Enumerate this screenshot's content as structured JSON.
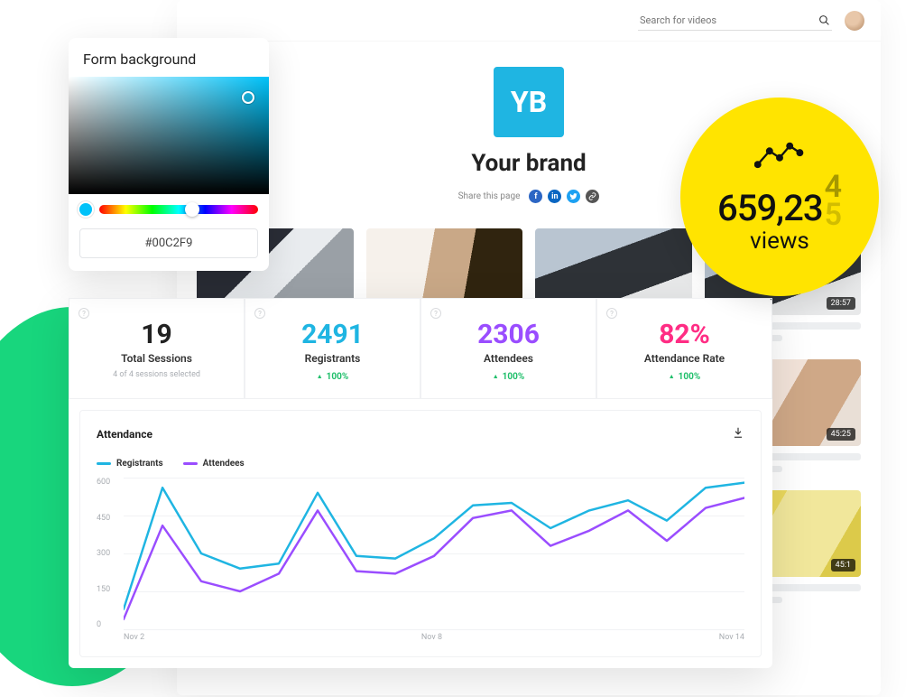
{
  "brand": {
    "logo_text": "YB",
    "name": "Your brand",
    "share_label": "Share this page",
    "search_placeholder": "Search for videos",
    "socials": [
      "facebook",
      "linkedin",
      "twitter",
      "link"
    ]
  },
  "thumbnails": [
    {
      "duration": ""
    },
    {
      "duration": ""
    },
    {
      "duration": ""
    },
    {
      "duration": "28:57"
    },
    {
      "duration": ""
    },
    {
      "duration": ""
    },
    {
      "duration": ""
    },
    {
      "duration": "45:25"
    },
    {
      "duration": ""
    },
    {
      "duration": ""
    },
    {
      "duration": ""
    },
    {
      "duration": "45:1"
    }
  ],
  "picker": {
    "title": "Form background",
    "hex": "#00C2F9"
  },
  "views_badge": {
    "count_prefix": "659,23",
    "ticker_top": "4",
    "ticker_bottom": "5",
    "label": "views"
  },
  "stats": [
    {
      "value": "19",
      "label": "Total Sessions",
      "sub": "4 of 4 sessions selected",
      "delta": "",
      "color": "c-black"
    },
    {
      "value": "2491",
      "label": "Registrants",
      "sub": "",
      "delta": "100%",
      "color": "c-teal"
    },
    {
      "value": "2306",
      "label": "Attendees",
      "sub": "",
      "delta": "100%",
      "color": "c-purple"
    },
    {
      "value": "82%",
      "label": "Attendance Rate",
      "sub": "",
      "delta": "100%",
      "color": "c-pink"
    }
  ],
  "chart": {
    "title": "Attendance",
    "legend": [
      {
        "name": "Registrants",
        "color": "teal"
      },
      {
        "name": "Attendees",
        "color": "purple"
      }
    ]
  },
  "chart_data": {
    "type": "line",
    "title": "Attendance",
    "xlabel": "",
    "ylabel": "",
    "ylim": [
      0,
      600
    ],
    "y_ticks": [
      600,
      450,
      300,
      150,
      0
    ],
    "categories": [
      "Nov 2",
      "",
      "",
      "",
      "",
      "",
      "Nov 8",
      "",
      "",
      "",
      "",
      "",
      "Nov 14"
    ],
    "series": [
      {
        "name": "Registrants",
        "values": [
          80,
          560,
          300,
          240,
          260,
          540,
          290,
          280,
          360,
          490,
          500,
          400,
          470,
          510,
          430,
          560,
          580
        ]
      },
      {
        "name": "Attendees",
        "values": [
          40,
          410,
          190,
          150,
          220,
          470,
          230,
          220,
          290,
          440,
          470,
          330,
          390,
          470,
          350,
          480,
          520
        ]
      }
    ]
  }
}
